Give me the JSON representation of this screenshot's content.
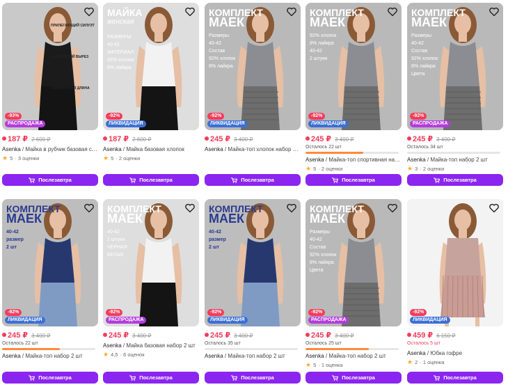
{
  "button_label": "Послезавтра",
  "colors": {
    "accent": "#8b25f0",
    "price": "#f23c5c",
    "liquidation": "#3c6fd6",
    "sale": "#b43cdc",
    "stock_bar": "#ff8a3c"
  },
  "products": [
    {
      "discount": "-93%",
      "promo": "РАСПРОДАЖА",
      "promo_type": "sale",
      "price": "187 ₽",
      "old_price": "2 600 ₽",
      "stock": "",
      "stock_fraction": null,
      "brand": "Asenka",
      "name": " / Майка в рубчик базовая спорт…",
      "rating": "5",
      "reviews": "· 3 оценки",
      "photo": "black",
      "overlay": {
        "lines": [
          "ПРИЛЕГАЮЩИЙ СИЛУЭТ",
          "U-ОБРАЗНЫЙ ВЫРЕЗ",
          "КОМФОРТНАЯ ДЛИНА"
        ]
      }
    },
    {
      "discount": "-92%",
      "promo": "ЛИКВИДАЦИЯ",
      "promo_type": "liq",
      "price": "187 ₽",
      "old_price": "2 600 ₽",
      "stock": "",
      "stock_fraction": null,
      "brand": "Asenka",
      "name": " / Майка базовая хлопок",
      "rating": "5",
      "reviews": "· 2 оценки",
      "photo": "white",
      "overlay": {
        "title": "МАЙКА",
        "subtitle": "женская",
        "lines": [
          "РАЗМЕРЫ",
          "40-42",
          "МАТЕРИАЛ:",
          "92% хлопок",
          "8% лайкра"
        ]
      }
    },
    {
      "discount": "-92%",
      "promo": "ЛИКВИДАЦИЯ",
      "promo_type": "liq",
      "price": "245 ₽",
      "old_price": "3 400 ₽",
      "stock": "",
      "stock_fraction": null,
      "brand": "Asenka",
      "name": " / Майка-топ хлопок набор 2 шт",
      "rating": "",
      "reviews": "",
      "photo": "gray",
      "overlay": {
        "title": "КОМПЛЕКТ",
        "title2": "МАЕК",
        "lines": [
          "Размеры",
          "40-42",
          "Состав",
          "92% хлопок",
          "8% лайкра"
        ]
      }
    },
    {
      "discount": "-92%",
      "promo": "ЛИКВИДАЦИЯ",
      "promo_type": "liq",
      "price": "245 ₽",
      "old_price": "3 400 ₽",
      "stock": "Осталось 22 шт",
      "stock_fraction": 0.62,
      "brand": "Asenka",
      "name": " / Майка-топ спортивная набор 2…",
      "rating": "5",
      "reviews": "· 2 оценки",
      "photo": "gray",
      "overlay": {
        "title": "КОМПЛЕКТ",
        "title2": "МАЕК",
        "lines": [
          "92% хлопок",
          "8% лайкра",
          "40-42",
          "2 штуки"
        ]
      }
    },
    {
      "discount": "-92%",
      "promo": "РАСПРОДАЖА",
      "promo_type": "sale",
      "price": "245 ₽",
      "old_price": "3 400 ₽",
      "stock": "Осталось 34 шт",
      "stock_fraction": 0.0,
      "brand": "Asenka",
      "name": " / Майка-топ набор 2 шт",
      "rating": "3",
      "reviews": "· 2 оценки",
      "photo": "gray",
      "overlay": {
        "title": "КОМПЛЕКТ",
        "title2": "МАЕК",
        "lines": [
          "Размеры",
          "40-42",
          "Состав",
          "92% хлопок",
          "8% лайкра",
          "Цвета"
        ]
      }
    },
    {
      "discount": "-92%",
      "promo": "ЛИКВИДАЦИЯ",
      "promo_type": "liq",
      "price": "245 ₽",
      "old_price": "3 400 ₽",
      "stock": "Осталось 22 шт",
      "stock_fraction": 0.62,
      "brand": "Asenka",
      "name": " / Майка-топ набор 2 шт",
      "rating": "",
      "reviews": "",
      "photo": "navy",
      "overlay": {
        "title": "КОМПЛЕКТ",
        "title2": "МАЕК",
        "lines": [
          "40-42",
          "размер",
          "2 шт"
        ]
      }
    },
    {
      "discount": "-92%",
      "promo": "РАСПРОДАЖА",
      "promo_type": "sale",
      "price": "245 ₽",
      "old_price": "3 400 ₽",
      "stock": "",
      "stock_fraction": null,
      "brand": "Asenka",
      "name": " / Майка базовая набор 2 шт",
      "rating": "4,5",
      "reviews": "· 6 оценок",
      "photo": "white",
      "overlay": {
        "title": "КОМПЛЕКТ",
        "title2": "МАЕК",
        "lines": [
          "40-42",
          "2 штуки",
          "ЧЕРНАЯ",
          "БЕЛАЯ"
        ]
      }
    },
    {
      "discount": "-92%",
      "promo": "ЛИКВИДАЦИЯ",
      "promo_type": "liq",
      "price": "245 ₽",
      "old_price": "3 400 ₽",
      "stock": "Осталось 35 шт",
      "stock_fraction": 0.0,
      "brand": "Asenka",
      "name": " / Майка-топ набор 2 шт",
      "rating": "",
      "reviews": "",
      "photo": "navy",
      "overlay": {
        "title": "КОМПЛЕКТ",
        "title2": "МАЕК",
        "lines": [
          "40-42",
          "размер",
          "2 шт"
        ]
      }
    },
    {
      "discount": "-92%",
      "promo": "РАСПРОДАЖА",
      "promo_type": "sale",
      "price": "245 ₽",
      "old_price": "3 400 ₽",
      "stock": "Осталось 25 шт",
      "stock_fraction": 0.68,
      "brand": "Asenka",
      "name": " / Майка-топ набор 2 шт",
      "rating": "5",
      "reviews": "· 1 оценка",
      "photo": "gray",
      "overlay": {
        "title": "КОМПЛЕКТ",
        "title2": "МАЕК",
        "lines": [
          "Размеры",
          "40-42",
          "Состав",
          "92% хлопок",
          "8% лайкра",
          "Цвета"
        ]
      }
    },
    {
      "discount": "-92%",
      "promo": "ЛИКВИДАЦИЯ",
      "promo_type": "liq",
      "price": "459 ₽",
      "old_price": "6 150 ₽",
      "stock": "Осталось 5 шт",
      "stock_fraction": null,
      "stock_red": true,
      "brand": "Asenka",
      "name": " / Юбка гофре",
      "rating": "2",
      "reviews": "· 1 оценка",
      "photo": "skirt",
      "overlay": {}
    }
  ]
}
